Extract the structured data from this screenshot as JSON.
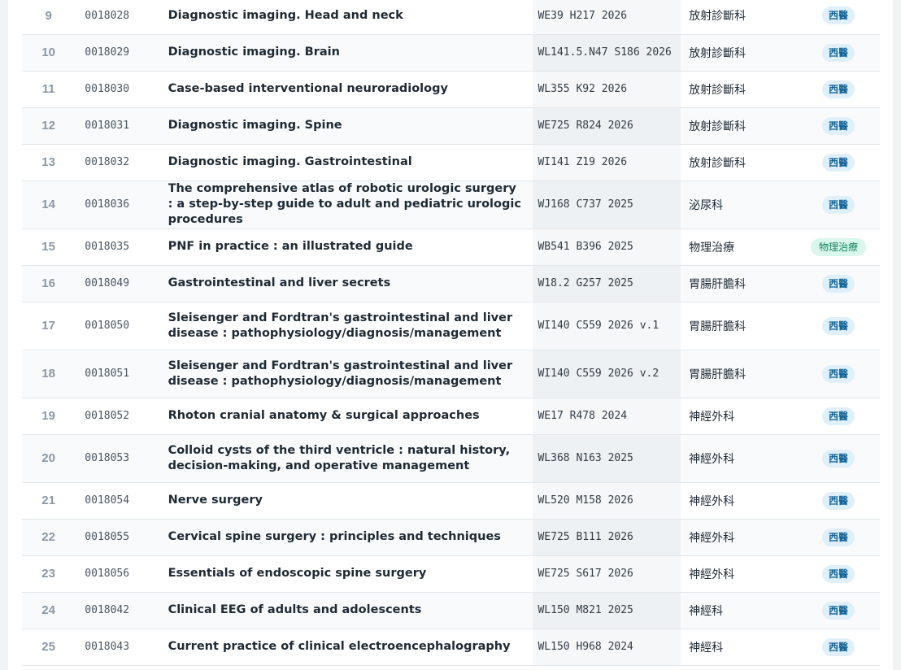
{
  "table": {
    "rows": [
      {
        "num": "9",
        "id": "0018028",
        "title": "Diagnostic imaging. Head and neck",
        "call": "WE39 H217 2026",
        "dept": "放射診斷科",
        "tag": "西醫",
        "tag_color": "#dff0fa"
      },
      {
        "num": "10",
        "id": "0018029",
        "title": "Diagnostic imaging. Brain",
        "call": "WL141.5.N47 S186 2026",
        "dept": "放射診斷科",
        "tag": "西醫",
        "tag_color": "#dff0fa"
      },
      {
        "num": "11",
        "id": "0018030",
        "title": "Case-based interventional neuroradiology",
        "call": "WL355 K92 2026",
        "dept": "放射診斷科",
        "tag": "西醫",
        "tag_color": "#dff0fa"
      },
      {
        "num": "12",
        "id": "0018031",
        "title": "Diagnostic imaging. Spine",
        "call": "WE725 R824 2026",
        "dept": "放射診斷科",
        "tag": "西醫",
        "tag_color": "#dff0fa"
      },
      {
        "num": "13",
        "id": "0018032",
        "title": "Diagnostic imaging. Gastrointestinal",
        "call": "WI141 Z19 2026",
        "dept": "放射診斷科",
        "tag": "西醫",
        "tag_color": "#dff0fa"
      },
      {
        "num": "14",
        "id": "0018036",
        "title": "The comprehensive atlas of robotic urologic surgery : a step-by-step guide to adult and pediatric urologic procedures",
        "call": "WJ168 C737 2025",
        "dept": "泌尿科",
        "tag": "西醫",
        "tag_color": "#dff0fa"
      },
      {
        "num": "15",
        "id": "0018035",
        "title": "PNF in practice : an illustrated guide",
        "call": "WB541 B396 2025",
        "dept": "物理治療",
        "tag": "物理治療",
        "tag_color": "#d9f7ec"
      },
      {
        "num": "16",
        "id": "0018049",
        "title": "Gastrointestinal and liver secrets",
        "call": "W18.2 G257 2025",
        "dept": "胃腸肝膽科",
        "tag": "西醫",
        "tag_color": "#dff0fa"
      },
      {
        "num": "17",
        "id": "0018050",
        "title": "Sleisenger and Fordtran's gastrointestinal and liver disease : pathophysiology/diagnosis/management",
        "call": "WI140 C559 2026 v.1",
        "dept": "胃腸肝膽科",
        "tag": "西醫",
        "tag_color": "#dff0fa"
      },
      {
        "num": "18",
        "id": "0018051",
        "title": "Sleisenger and Fordtran's gastrointestinal and liver disease : pathophysiology/diagnosis/management",
        "call": "WI140 C559 2026 v.2",
        "dept": "胃腸肝膽科",
        "tag": "西醫",
        "tag_color": "#dff0fa"
      },
      {
        "num": "19",
        "id": "0018052",
        "title": "Rhoton cranial anatomy & surgical approaches",
        "call": "WE17 R478 2024",
        "dept": "神經外科",
        "tag": "西醫",
        "tag_color": "#dff0fa"
      },
      {
        "num": "20",
        "id": "0018053",
        "title": "Colloid cysts of the third ventricle : natural history, decision-making, and operative management",
        "call": "WL368 N163 2025",
        "dept": "神經外科",
        "tag": "西醫",
        "tag_color": "#dff0fa"
      },
      {
        "num": "21",
        "id": "0018054",
        "title": "Nerve surgery",
        "call": "WL520 M158 2026",
        "dept": "神經外科",
        "tag": "西醫",
        "tag_color": "#dff0fa"
      },
      {
        "num": "22",
        "id": "0018055",
        "title": "Cervical spine surgery : principles and techniques",
        "call": "WE725 B111 2026",
        "dept": "神經外科",
        "tag": "西醫",
        "tag_color": "#dff0fa"
      },
      {
        "num": "23",
        "id": "0018056",
        "title": "Essentials of endoscopic spine surgery",
        "call": "WE725 S617 2026",
        "dept": "神經外科",
        "tag": "西醫",
        "tag_color": "#dff0fa"
      },
      {
        "num": "24",
        "id": "0018042",
        "title": "Clinical EEG of adults and adolescents",
        "call": "WL150 M821 2025",
        "dept": "神經科",
        "tag": "西醫",
        "tag_color": "#dff0fa"
      },
      {
        "num": "25",
        "id": "0018043",
        "title": "Current practice of clinical electroencephalography",
        "call": "WL150 H968 2024",
        "dept": "神經科",
        "tag": "西醫",
        "tag_color": "#dff0fa"
      }
    ]
  }
}
